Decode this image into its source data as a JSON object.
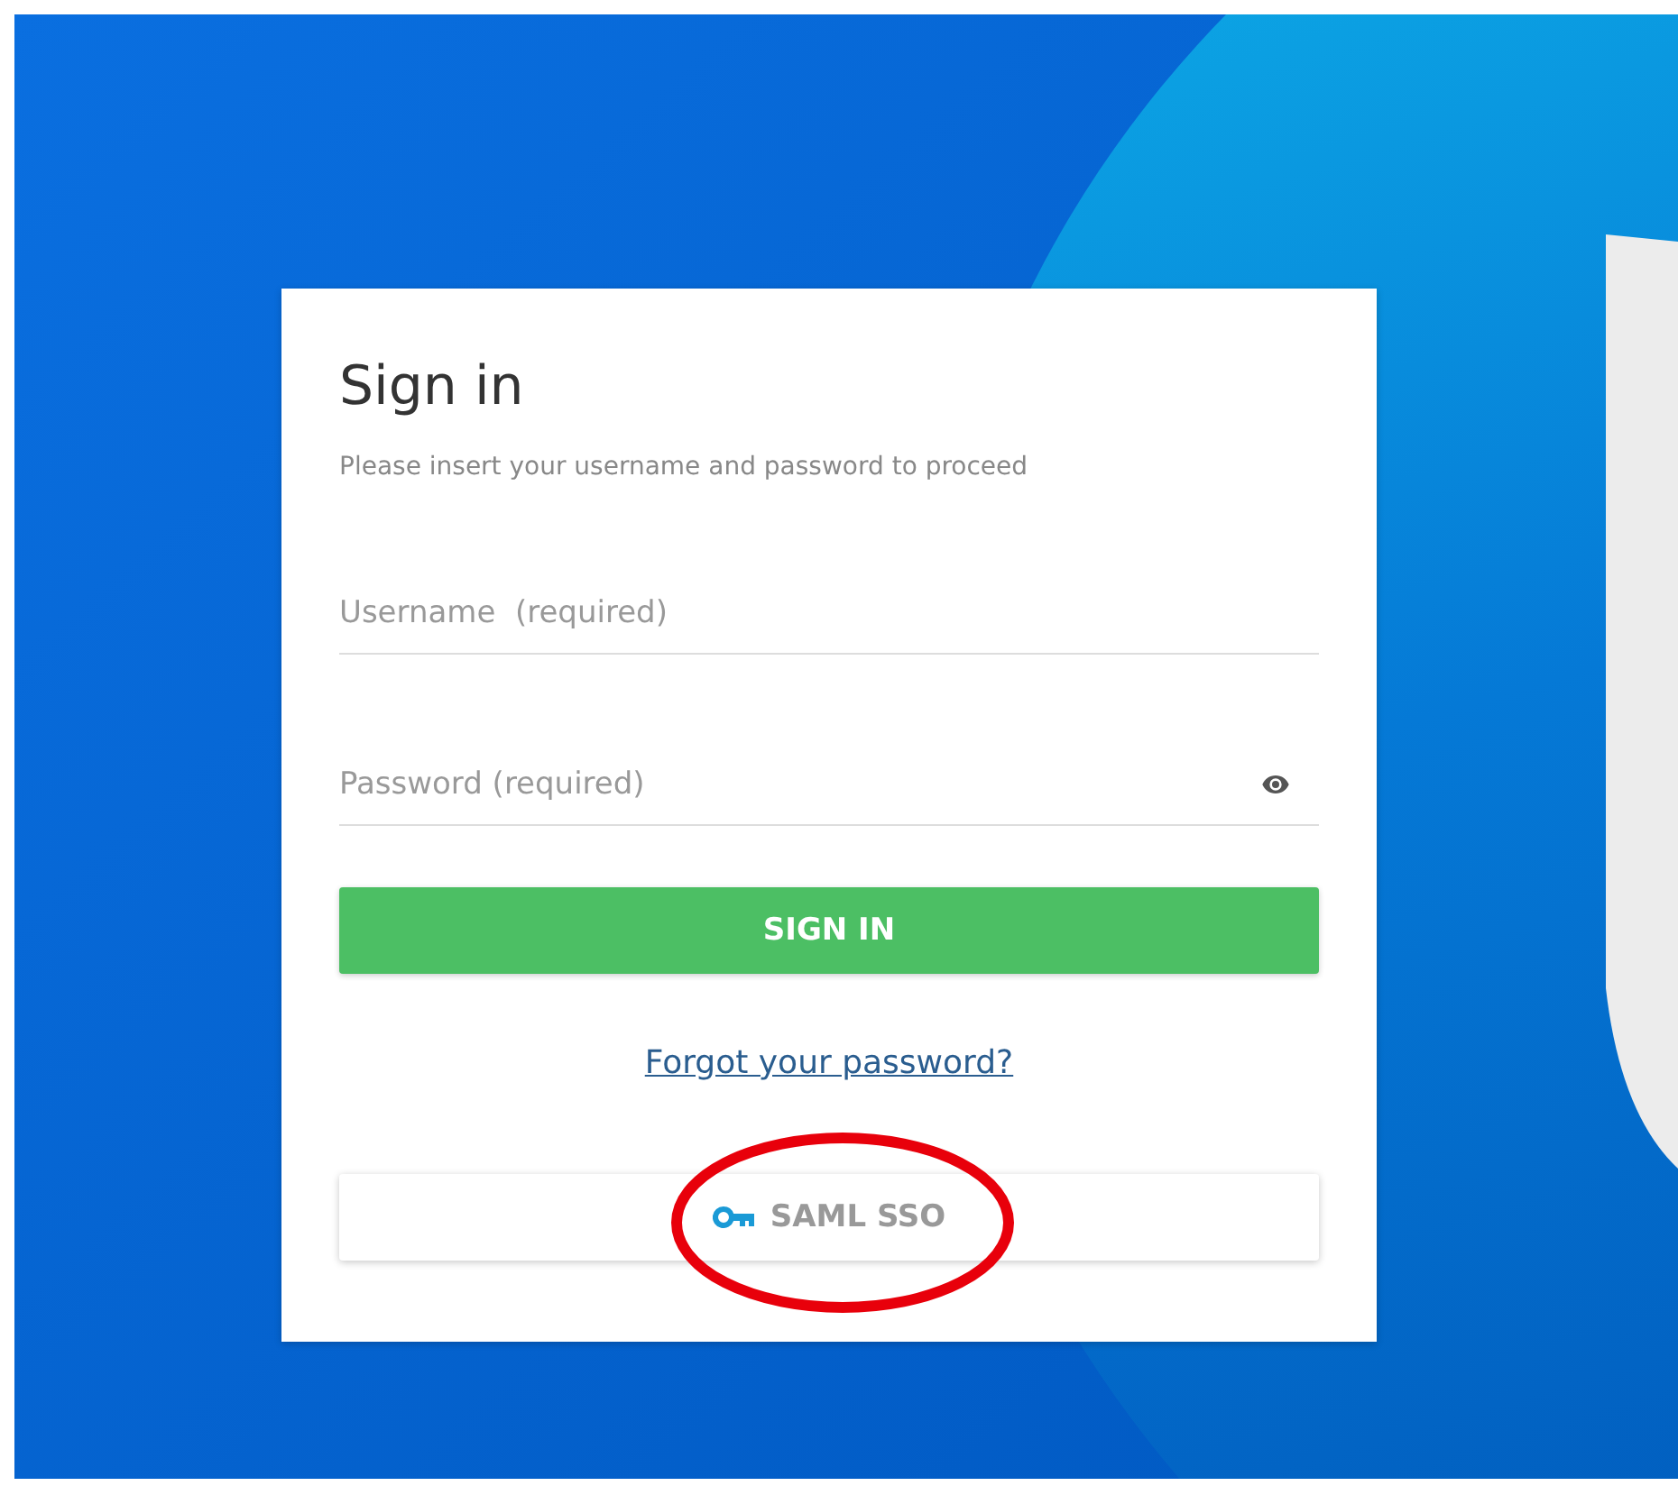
{
  "card": {
    "title": "Sign in",
    "subtitle": "Please insert your username and password to proceed",
    "fields": [
      {
        "kind": "text",
        "placeholder": "Username  (required)"
      },
      {
        "kind": "password",
        "placeholder": "Password (required)"
      }
    ],
    "sign_in_button": "SIGN IN",
    "forgot_link": "Forgot your password?",
    "sso_button": "SAML SSO"
  }
}
